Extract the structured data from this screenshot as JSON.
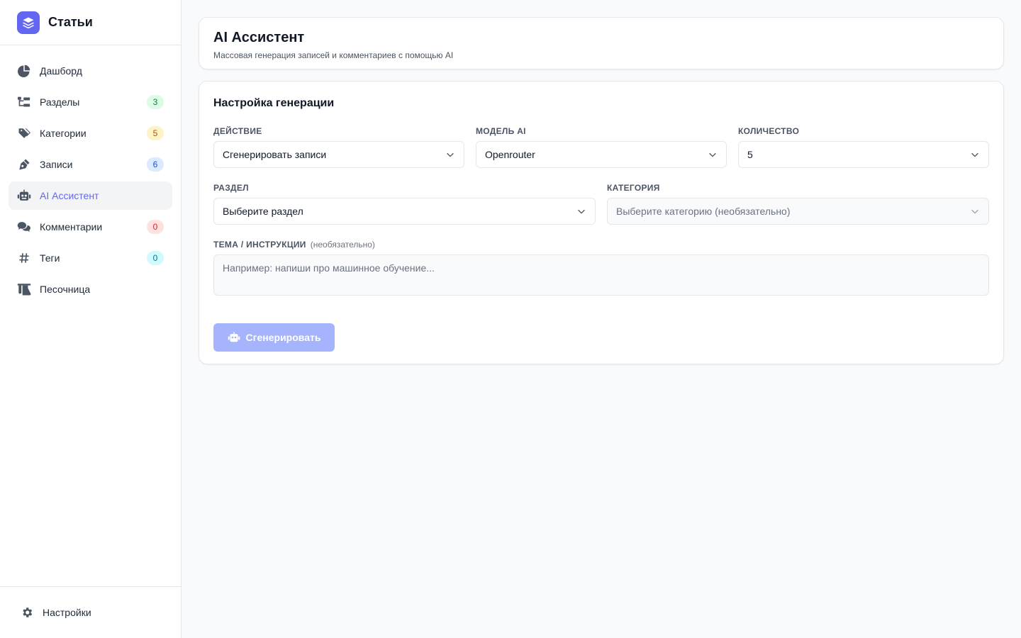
{
  "brand": {
    "title": "Статьи",
    "icon": "layers-icon"
  },
  "sidebar": {
    "items": [
      {
        "label": "Дашборд",
        "icon": "pie-chart-icon",
        "badge": null
      },
      {
        "label": "Разделы",
        "icon": "folder-tree-icon",
        "badge": "3"
      },
      {
        "label": "Категории",
        "icon": "tags-icon",
        "badge": "5"
      },
      {
        "label": "Записи",
        "icon": "pen-nib-icon",
        "badge": "6"
      },
      {
        "label": "AI Ассистент",
        "icon": "robot-icon",
        "badge": null,
        "active": true
      },
      {
        "label": "Комментарии",
        "icon": "comments-icon",
        "badge": "0"
      },
      {
        "label": "Теги",
        "icon": "hashtag-icon",
        "badge": "0"
      },
      {
        "label": "Песочница",
        "icon": "flask-icon",
        "badge": null
      }
    ],
    "footer": {
      "label": "Настройки",
      "icon": "gear-icon"
    }
  },
  "header": {
    "title": "AI Ассистент",
    "subtitle": "Массовая генерация записей и комментариев с помощью AI"
  },
  "form": {
    "title": "Настройка генерации",
    "action": {
      "label": "Действие",
      "value": "Сгенерировать записи"
    },
    "model": {
      "label": "Модель AI",
      "value": "Openrouter"
    },
    "count": {
      "label": "Количество",
      "value": "5"
    },
    "section": {
      "label": "Раздел",
      "value": "Выберите раздел"
    },
    "category": {
      "label": "Категория",
      "value": "Выберите категорию (необязательно)",
      "disabled": true
    },
    "topic": {
      "label": "Тема / Инструкции",
      "optional": "(необязательно)",
      "placeholder": "Например: напиши про машинное обучение..."
    },
    "submit_label": "Сгенерировать"
  },
  "colors": {
    "accent": "#6366f1",
    "button_disabled": "#a5b4fc"
  }
}
